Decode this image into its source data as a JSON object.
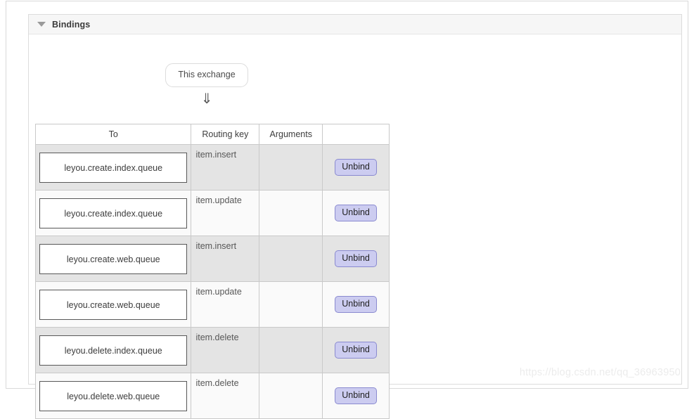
{
  "panel": {
    "title": "Bindings",
    "toggle_icon": "triangle-down-icon",
    "expanded": true
  },
  "source": {
    "label": "This exchange",
    "arrow_glyph": "⇓",
    "arrow_icon": "double-down-arrow-icon"
  },
  "table": {
    "columns": [
      "To",
      "Routing key",
      "Arguments",
      ""
    ],
    "rows": [
      {
        "to": "leyou.create.index.queue",
        "routing_key": "item.insert",
        "arguments": "",
        "action": "Unbind"
      },
      {
        "to": "leyou.create.index.queue",
        "routing_key": "item.update",
        "arguments": "",
        "action": "Unbind"
      },
      {
        "to": "leyou.create.web.queue",
        "routing_key": "item.insert",
        "arguments": "",
        "action": "Unbind"
      },
      {
        "to": "leyou.create.web.queue",
        "routing_key": "item.update",
        "arguments": "",
        "action": "Unbind"
      },
      {
        "to": "leyou.delete.index.queue",
        "routing_key": "item.delete",
        "arguments": "",
        "action": "Unbind"
      },
      {
        "to": "leyou.delete.web.queue",
        "routing_key": "item.delete",
        "arguments": "",
        "action": "Unbind"
      }
    ]
  },
  "watermark": {
    "text": "https://blog.csdn.net/qq_36963950"
  },
  "colors": {
    "panel_header_bg": "#f6f6f6",
    "row_shade": "#e4e4e4",
    "row_plain": "#fafafa",
    "unbind_bg": "#ccccf0",
    "unbind_border": "#8a8ad0",
    "table_border": "#c9c9c9",
    "queue_box_border": "#585858",
    "watermark": "#ececec"
  }
}
